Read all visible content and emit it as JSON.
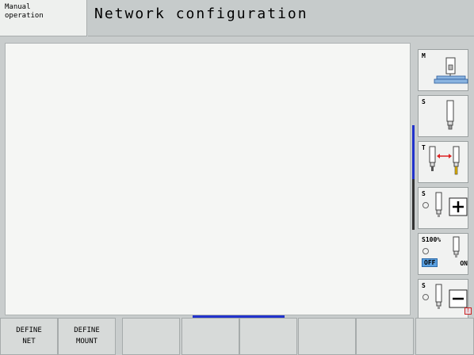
{
  "header": {
    "mode_line1": "Manual",
    "mode_line2": "operation",
    "title": "Network configuration"
  },
  "vertical_softkeys": [
    {
      "label": "M",
      "icon": "machine-table-icon"
    },
    {
      "label": "S",
      "icon": "spindle-tool-icon"
    },
    {
      "label": "T",
      "icon": "tool-change-icon"
    },
    {
      "label": "S",
      "icon": "spindle-plus-icon"
    },
    {
      "label": "S100%",
      "icon": "spindle-override-icon",
      "off_label": "OFF",
      "on_label": "ON"
    },
    {
      "label": "S",
      "icon": "spindle-minus-icon"
    }
  ],
  "horizontal_softkeys": [
    {
      "line1": "DEFINE",
      "line2": "NET"
    },
    {
      "line1": "DEFINE",
      "line2": "MOUNT"
    },
    {
      "line1": "",
      "line2": ""
    },
    {
      "line1": "",
      "line2": ""
    },
    {
      "line1": "",
      "line2": ""
    },
    {
      "line1": "",
      "line2": ""
    },
    {
      "line1": "",
      "line2": ""
    },
    {
      "line1": "",
      "line2": ""
    }
  ],
  "colors": {
    "accent_blue": "#2233cc",
    "warning_red": "#cc2222",
    "off_blue": "#5aa0e0"
  }
}
